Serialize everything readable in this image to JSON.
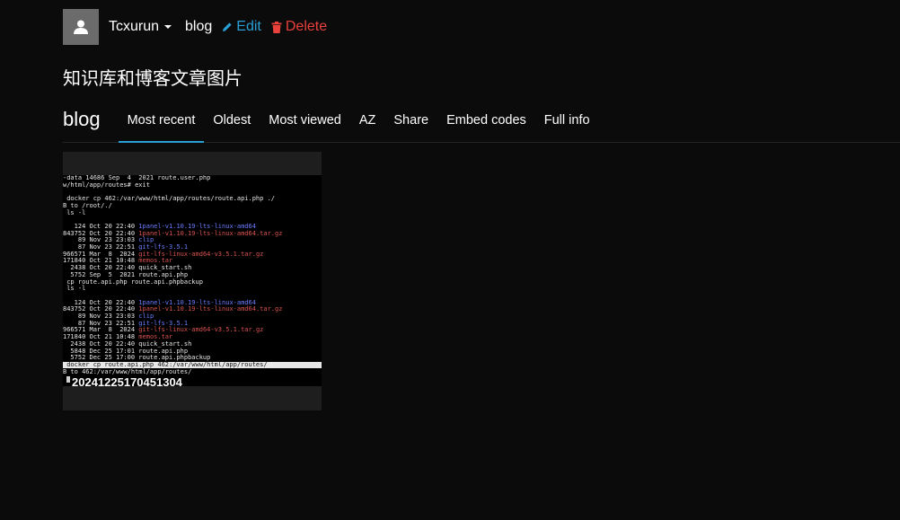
{
  "header": {
    "username": "Tcxurun",
    "album": "blog",
    "edit_label": "Edit",
    "delete_label": "Delete"
  },
  "description": "知识库和博客文章图片",
  "section_title": "blog",
  "tabs": [
    {
      "label": "Most recent",
      "active": true
    },
    {
      "label": "Oldest"
    },
    {
      "label": "Most viewed"
    },
    {
      "label": "AZ"
    },
    {
      "label": "Share"
    },
    {
      "label": "Embed codes"
    },
    {
      "label": "Full info"
    }
  ],
  "image": {
    "caption": "20241225170451304",
    "terminal_lines": [
      {
        "t": "-data 14686 Sep  4  2021 route.user.php"
      },
      {
        "t": "w/html/app/routes# exit"
      },
      {
        "t": ""
      },
      {
        "t": " docker cp 462:/var/www/html/app/routes/route.api.php ./"
      },
      {
        "t": "B to /root/./"
      },
      {
        "t": " ls -l"
      },
      {
        "t": ""
      },
      {
        "t": "   124 Oct 20 22:40 ",
        "h": "1panel-v1.10.19-lts-linux-amd64",
        "c": "blue"
      },
      {
        "t": "843752 Oct 20 22:40 ",
        "h": "1panel-v1.10.19-lts-linux-amd64.tar.gz",
        "c": "red"
      },
      {
        "t": "    89 Nov 23 23:03 ",
        "h": "clip",
        "c": "blue"
      },
      {
        "t": "    87 Nov 23 22:51 ",
        "h": "git-lfs-3.5.1",
        "c": "blue"
      },
      {
        "t": "966571 Mar  8  2024 ",
        "h": "git-lfs-linux-amd64-v3.5.1.tar.gz",
        "c": "red"
      },
      {
        "t": "171840 Oct 21 10:48 ",
        "h": "memos.tar",
        "c": "red"
      },
      {
        "t": "  2438 Oct 20 22:40 quick_start.sh"
      },
      {
        "t": "  5752 Sep  5  2021 route.api.php"
      },
      {
        "t": " cp route.api.php route.api.phpbackup"
      },
      {
        "t": " ls -l"
      },
      {
        "t": ""
      },
      {
        "t": "   124 Oct 20 22:40 ",
        "h": "1panel-v1.10.19-lts-linux-amd64",
        "c": "blue"
      },
      {
        "t": "843752 Oct 20 22:40 ",
        "h": "1panel-v1.10.19-lts-linux-amd64.tar.gz",
        "c": "red"
      },
      {
        "t": "    89 Nov 23 23:03 ",
        "h": "clip",
        "c": "blue"
      },
      {
        "t": "    87 Nov 23 22:51 ",
        "h": "git-lfs-3.5.1",
        "c": "blue"
      },
      {
        "t": "966571 Mar  8  2024 ",
        "h": "git-lfs-linux-amd64-v3.5.1.tar.gz",
        "c": "red"
      },
      {
        "t": "171840 Oct 21 10:48 ",
        "h": "memos.tar",
        "c": "red"
      },
      {
        "t": "  2438 Oct 20 22:40 quick_start.sh"
      },
      {
        "t": "  5848 Dec 25 17:01 route.api.php"
      },
      {
        "t": "  5752 Dec 25 17:00 route.api.phpbackup"
      },
      {
        "t": " docker cp route.api.php 462:/var/www/html/app/routes/",
        "sel": true
      },
      {
        "t": "B to 462:/var/www/html/app/routes/"
      }
    ]
  },
  "colors": {
    "background": "#0b0b0b",
    "accent": "#2a9fd6",
    "danger": "#e8413c"
  },
  "icons": {
    "avatar": "user-icon",
    "edit": "pencil-icon",
    "delete": "trash-icon",
    "user_menu": "caret-down-icon"
  }
}
